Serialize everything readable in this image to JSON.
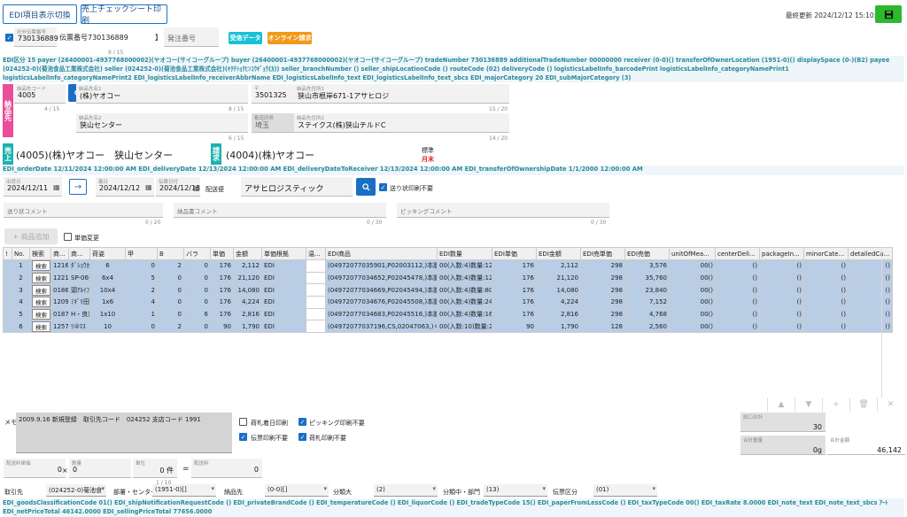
{
  "toolbar": {
    "toggle_label": "EDI項目表示切換",
    "print_label": "売上チェックシート印刷",
    "last_updated": "最終更新 2024/12/12 15:10:28"
  },
  "header": {
    "company_order_label": "社外伝票番号",
    "company_order_value": "730136889",
    "company_order_counter": "9 / 15",
    "slip_number_label": "伝票番号",
    "slip_number_value": "730136889",
    "order_number_label": "発注番号",
    "badge_received": "受信データ",
    "badge_online": "オンライン請求"
  },
  "edi_block1": "EDI区分 15  payer (26400001-4937768000002)(ヤオコー(サイコーグループ)  buyer (26400001-4937768000002)(ヤオコー(サイコーグループ)  tradeNumber 730136889  additionalTradeNumber 00000000  receiver (0-0)()  transferOfOwnerLocation (1951-0)()  displaySpace (0-)(B2)  payee (024252-0)(菊池食品工業株式会社)  seller (024252-0)(菊池食品工業株式会社)(ｷｸﾁｼｮｸﾋﾝｺｳｷﾞｮｳ(ｶ))  seller_branchNumber ()  seller_shipLocationCode ()  routeCode (02)  deliveryCode ()  logisticsLabelInfo_barcodePrint  logisticsLabelInfo_categoryNamePrint1  logisticsLabelInfo_categoryNamePrint2  EDI_logisticsLabelInfo_receiverAbbrName  EDI_logisticsLabelInfo_text  EDI_logisticsLabelInfo_text_sbcs  EDI_majorCategory 20  EDI_subMajorCategory (3)",
  "delivery": {
    "tag": "納品先",
    "code_label": "納品先コード",
    "code_value": "4005",
    "code_counter": "4 / 15",
    "name1_label": "納品先名1",
    "name1_value": "(株)ヤオコー",
    "name1_counter": "8 / 15",
    "zip_label": "〒",
    "zip_value": "3501325",
    "addr1_label": "納品先住所1",
    "addr1_value": "狭山市根岸671-1アサヒロジ",
    "addr1_counter": "15 / 20",
    "name2_label": "納品先名2",
    "name2_value": "狭山センター",
    "name2_counter": "6 / 15",
    "pref_label": "都道府県",
    "pref_value": "埼玉",
    "addr2_label": "納品先住所2",
    "addr2_value": "ステイクス(株)狭山チルドC",
    "addr2_counter": "14 / 20"
  },
  "sales": {
    "tag_sales": "売上",
    "sales_value": "(4005)(株)ヤオコー　狭山センター",
    "tag_billing": "請求",
    "billing_value": "(4004)(株)ヤオコー",
    "standard_label": "標準",
    "cycle_label": "月末"
  },
  "edi_block2": "EDI_orderDate 12/11/2024 12:00:00 AM  EDI_deliveryDate 12/13/2024 12:00:00 AM  EDI_deliveryDateToReceiver 12/13/2024 12:00:00 AM  EDI_transferOfOwnershipDate 1/1/2000 12:00:00 AM",
  "dates": {
    "order_label": "出荷日",
    "order_value": "2024/12/11",
    "arrival_label": "着日",
    "arrival_value": "2024/12/12",
    "delivery_label": "伝票日付",
    "delivery_value": "2024/12/13",
    "carrier_label": "配送便",
    "carrier_value": "アサヒロジスティック",
    "no_slip_print": "送り状印刷不要"
  },
  "comments": {
    "invoice_label": "送り状コメント",
    "invoice_counter": "0 / 20",
    "delivery_label": "納品書コメント",
    "delivery_counter": "0 / 30",
    "picking_label": "ピッキングコメント",
    "picking_counter": "0 / 30"
  },
  "items_toolbar": {
    "add_label": "+ 商品追加",
    "unit_change_label": "単価変更"
  },
  "grid": {
    "columns": [
      "!",
      "No.",
      "検索",
      "商...",
      "商...",
      "荷姿",
      "甲",
      "B",
      "バラ",
      "単価",
      "金額",
      "単価根拠",
      "温...",
      "EDI商品",
      "EDI数量",
      "EDI単価",
      "EDI金額",
      "EDI売単価",
      "EDI売価",
      "unitOfMea...",
      "centerDeli...",
      "packageIn...",
      "minorCate...",
      "detailedCa..."
    ],
    "search_label": "検索",
    "rows": [
      {
        "no": "1",
        "code": "121604",
        "name": "ﾀﾞｼｮｳｶｽﾄ",
        "pack": "6",
        "a": "0",
        "b": "2",
        "bara": "0",
        "price": "176",
        "amount": "2,112",
        "basis": "EDI",
        "edi_item": "(04972077035901,P02003112,)本膳便",
        "edi_qty": "00(入数:4)数量:12",
        "edi_price": "176",
        "edi_amount": "2,112",
        "edi_sell_price": "298",
        "edi_sell": "3,576",
        "unit": "00()"
      },
      {
        "no": "2",
        "code": "122105",
        "name": "SP-06ﾁ",
        "pack": "6x4",
        "a": "5",
        "b": "0",
        "bara": "0",
        "price": "176",
        "amount": "21,120",
        "basis": "EDI",
        "edi_item": "(04972077034652,P02045478,)本膳便",
        "edi_qty": "00(入数:4)数量:120",
        "edi_price": "176",
        "edi_amount": "21,120",
        "edi_sell_price": "298",
        "edi_sell": "35,760",
        "unit": "00()"
      },
      {
        "no": "3",
        "code": "018697",
        "name": "頭ｱﾙｲﾌﾟ",
        "pack": "10x4",
        "a": "2",
        "b": "0",
        "bara": "0",
        "price": "176",
        "amount": "14,080",
        "basis": "EDI",
        "edi_item": "(04972077034669,P02045494,)本膳便",
        "edi_qty": "00(入数:4)数量:80",
        "edi_price": "176",
        "edi_amount": "14,080",
        "edi_sell_price": "298",
        "edi_sell": "23,840",
        "unit": "00()"
      },
      {
        "no": "4",
        "code": "120996",
        "name": "ﾐｷﾞﾘ田",
        "pack": "1x6",
        "a": "4",
        "b": "0",
        "bara": "0",
        "price": "176",
        "amount": "4,224",
        "basis": "EDI",
        "edi_item": "(04972077034676,P02045508,)本膳便",
        "edi_qty": "00(入数:4)数量:24",
        "edi_price": "176",
        "edi_amount": "4,224",
        "edi_sell_price": "298",
        "edi_sell": "7,152",
        "unit": "00()"
      },
      {
        "no": "5",
        "code": "018736",
        "name": "H・良)",
        "pack": "1x10",
        "a": "1",
        "b": "0",
        "bara": "6",
        "price": "176",
        "amount": "2,816",
        "basis": "EDI",
        "edi_item": "(04972077034683,P02045516,)本膳便",
        "edi_qty": "00(入数:4)数量:16",
        "edi_price": "176",
        "edi_amount": "2,816",
        "edi_sell_price": "298",
        "edi_sell": "4,768",
        "unit": "00()"
      },
      {
        "no": "6",
        "code": "125782",
        "name": "ﾘ②ﾏｽ",
        "pack": "10",
        "a": "0",
        "b": "2",
        "bara": "0",
        "price": "90",
        "amount": "1,790",
        "basis": "EDI",
        "edi_item": "(04972077037196,CS,02047063,)くらく",
        "edi_qty": "00(入数:10)数量:20",
        "edi_price": "90",
        "edi_amount": "1,790",
        "edi_sell_price": "128",
        "edi_sell": "2,560",
        "unit": "00()"
      }
    ]
  },
  "grid_tools": [
    "▲",
    "▼",
    "+",
    "🗑",
    "✕"
  ],
  "memo": {
    "label": "メモ",
    "text": "2009.9.16 新規登録　取引先コード　024252 支店コード 1991",
    "counter": "1 / 10",
    "cb_nifuda_date": "荷札着日印刷",
    "cb_picking": "ピッキング印刷不要",
    "cb_slip": "伝票印刷不要",
    "cb_nifuda": "荷札印刷不要"
  },
  "totals": {
    "qty_total_label": "総口合計",
    "qty_total_value": "30",
    "weight_label": "合計重量",
    "weight_value": "0g",
    "amount_label": "合計金額",
    "amount_value": "46,142"
  },
  "calc": {
    "unit_label": "配送料単価",
    "unit_value": "0",
    "qty_label": "数量",
    "qty_value": "0",
    "unit2_label": "単位",
    "unit2_value": "0 件",
    "fee_label": "配送料",
    "fee_value": "0"
  },
  "bottom": {
    "trade_label": "取引先",
    "trade_value": "(024252-0)菊池食",
    "dept_label": "部署・センター",
    "dept_value": "(1951-0)[]",
    "delivery_label": "納品先",
    "delivery_value": "(0-0)[]",
    "cat_label": "分類大",
    "cat_value": "(2)",
    "cat_mid_label": "分類中・部門",
    "cat_mid_value": "(13)",
    "slip_label": "伝票区分",
    "slip_value": "(01)"
  },
  "edi_block3": "EDI_goodsClassificationCode 01()  EDI_shipNotificationRequestCode ()  EDI_privateBrandCode ()  EDI_temperatureCode ()  EDI_liquorCode ()  EDI_tradeTypeCode 15()  EDI_paperFromLessCode ()  EDI_taxTypeCode 00()  EDI_taxRate 8.0000  EDI_note_text  EDI_note_text_sbcs ｱｰﾄ  EDI_netPriceTotal 46142.0000  EDI_sellingPriceTotal 77656.0000",
  "colors": {
    "accent": "#1a6fc4",
    "save_green": "#2eb82e",
    "badge_cyan": "#19c1d6",
    "badge_orange": "#f29a1a",
    "tag_pink": "#ea4d9a",
    "tag_teal": "#1bb3b0",
    "row_blue": "#b8cde6"
  }
}
